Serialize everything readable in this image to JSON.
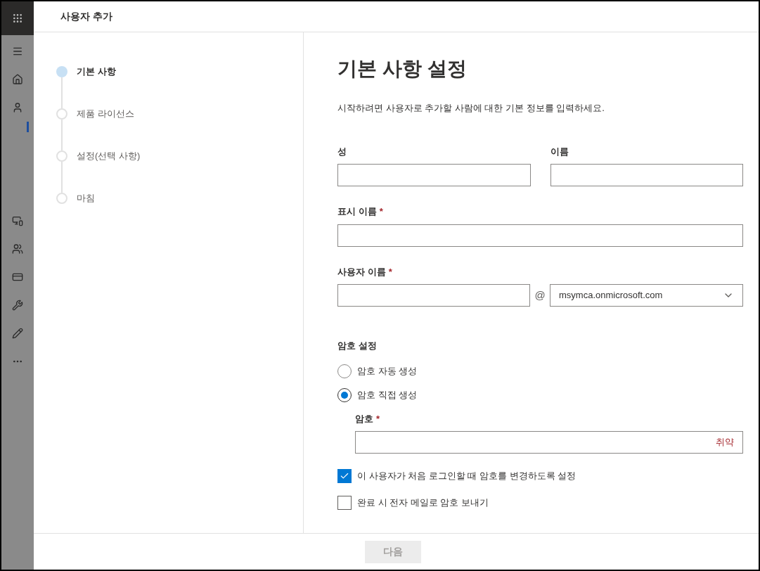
{
  "panel": {
    "title": "사용자 추가"
  },
  "steps": [
    {
      "label": "기본 사항",
      "selected": true
    },
    {
      "label": "제품 라이선스",
      "selected": false
    },
    {
      "label": "설정(선택 사항)",
      "selected": false
    },
    {
      "label": "마침",
      "selected": false
    }
  ],
  "form": {
    "heading": "기본 사항 설정",
    "description": "시작하려면 사용자로 추가할 사람에 대한 기본 정보를 입력하세요.",
    "last_name_label": "성",
    "first_name_label": "이름",
    "display_name_label": "표시 이름",
    "username_label": "사용자 이름",
    "required_mark": "*",
    "at_sign": "@",
    "domain": "msymca.onmicrosoft.com",
    "password_section": "암호 설정",
    "password_options": [
      {
        "label": "암호 자동 생성",
        "selected": false
      },
      {
        "label": "암호 직접 생성",
        "selected": true
      }
    ],
    "password_label": "암호",
    "password_strength": "취약",
    "checkboxes": [
      {
        "label": "이 사용자가 처음 로그인할 때 암호를 변경하도록 설정",
        "checked": true
      },
      {
        "label": "완료 시 전자 메일로 암호 보내기",
        "checked": false
      }
    ]
  },
  "footer": {
    "next_button": {
      "label": "다음",
      "disabled": true
    }
  }
}
